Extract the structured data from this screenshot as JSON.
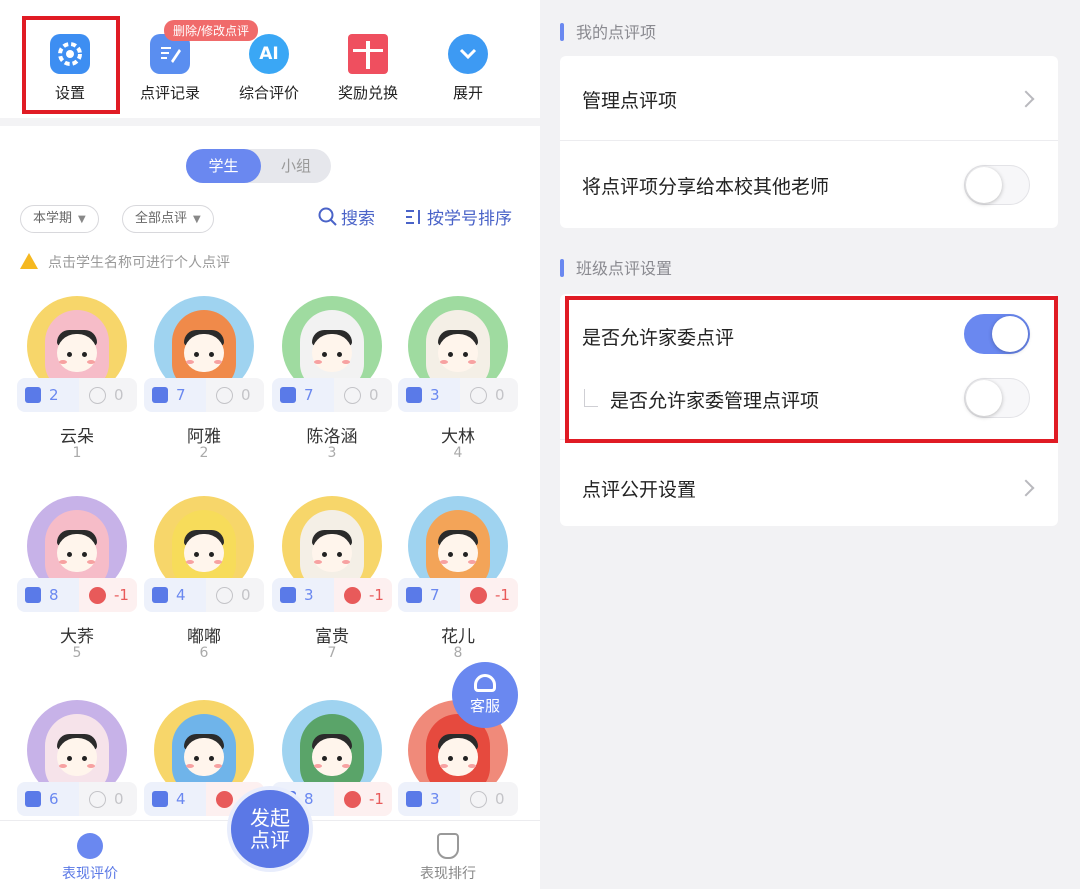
{
  "colors": {
    "accent": "#6a88f0",
    "highlight": "#e01b24",
    "negative": "#e85a5a"
  },
  "topbar": {
    "items": [
      {
        "label": "设置",
        "icon": "gear-icon",
        "color": "#3d8ef2"
      },
      {
        "label": "点评记录",
        "icon": "edit-record-icon",
        "color": "#5a8ef0"
      },
      {
        "label": "综合评价",
        "icon": "ai-badge-icon",
        "color": "#3aa7f5"
      },
      {
        "label": "奖励兑换",
        "icon": "gift-icon",
        "color": "#ef4f5f"
      },
      {
        "label": "展开",
        "icon": "expand-down-icon",
        "color": "#3d9af3"
      }
    ],
    "tag": "删除/修改点评"
  },
  "segment": {
    "student": "学生",
    "group": "小组"
  },
  "filters": {
    "term": "本学期",
    "review": "全部点评"
  },
  "tools": {
    "search": "搜索",
    "sort": "按学号排序"
  },
  "hint": "点击学生名称可进行个人点评",
  "students": [
    {
      "name": "云朵",
      "num": "1",
      "likes": "2",
      "dislikes": "0",
      "neg": false,
      "bg": "#f7d66a",
      "hood": "#f6bcc8"
    },
    {
      "name": "阿雅",
      "num": "2",
      "likes": "7",
      "dislikes": "0",
      "neg": false,
      "bg": "#9fd3f0",
      "hood": "#f08a4a"
    },
    {
      "name": "陈洛涵",
      "num": "3",
      "likes": "7",
      "dislikes": "0",
      "neg": false,
      "bg": "#9fdba0",
      "hood": "#f2f2f2"
    },
    {
      "name": "大林",
      "num": "4",
      "likes": "3",
      "dislikes": "0",
      "neg": false,
      "bg": "#9fdba0",
      "hood": "#f4efe6"
    },
    {
      "name": "大荞",
      "num": "5",
      "likes": "8",
      "dislikes": "-1",
      "neg": true,
      "bg": "#c7b2e8",
      "hood": "#f6bcc8"
    },
    {
      "name": "嘟嘟",
      "num": "6",
      "likes": "4",
      "dislikes": "0",
      "neg": false,
      "bg": "#f7d66a",
      "hood": "#f7dc5a"
    },
    {
      "name": "富贵",
      "num": "7",
      "likes": "3",
      "dislikes": "-1",
      "neg": true,
      "bg": "#f7d66a",
      "hood": "#f4efe6"
    },
    {
      "name": "花儿",
      "num": "8",
      "likes": "7",
      "dislikes": "-1",
      "neg": true,
      "bg": "#9fd3f0",
      "hood": "#f3a458"
    },
    {
      "name": "",
      "num": "",
      "likes": "6",
      "dislikes": "0",
      "neg": false,
      "bg": "#c7b2e8",
      "hood": "#f6e3ea"
    },
    {
      "name": "",
      "num": "",
      "likes": "4",
      "dislikes": "",
      "neg": true,
      "bg": "#f7d66a",
      "hood": "#6fb4ea"
    },
    {
      "name": "",
      "num": "",
      "likes": "8",
      "dislikes": "-1",
      "neg": true,
      "bg": "#9fd3f0",
      "hood": "#5aa469"
    },
    {
      "name": "",
      "num": "",
      "likes": "3",
      "dislikes": "0",
      "neg": false,
      "bg": "#f08a7a",
      "hood": "#e64a3e"
    }
  ],
  "kefu": "客服",
  "bottom": {
    "left": "表现评价",
    "fab": "发起点评",
    "right": "表现排行"
  },
  "right": {
    "section1_title": "我的点评项",
    "manage": "管理点评项",
    "share": "将点评项分享给本校其他老师",
    "section2_title": "班级点评设置",
    "allow_family": "是否允许家委点评",
    "allow_family_manage": "是否允许家委管理点评项",
    "public_setting": "点评公开设置",
    "share_on": false,
    "allow_family_on": true,
    "allow_family_manage_on": false
  }
}
